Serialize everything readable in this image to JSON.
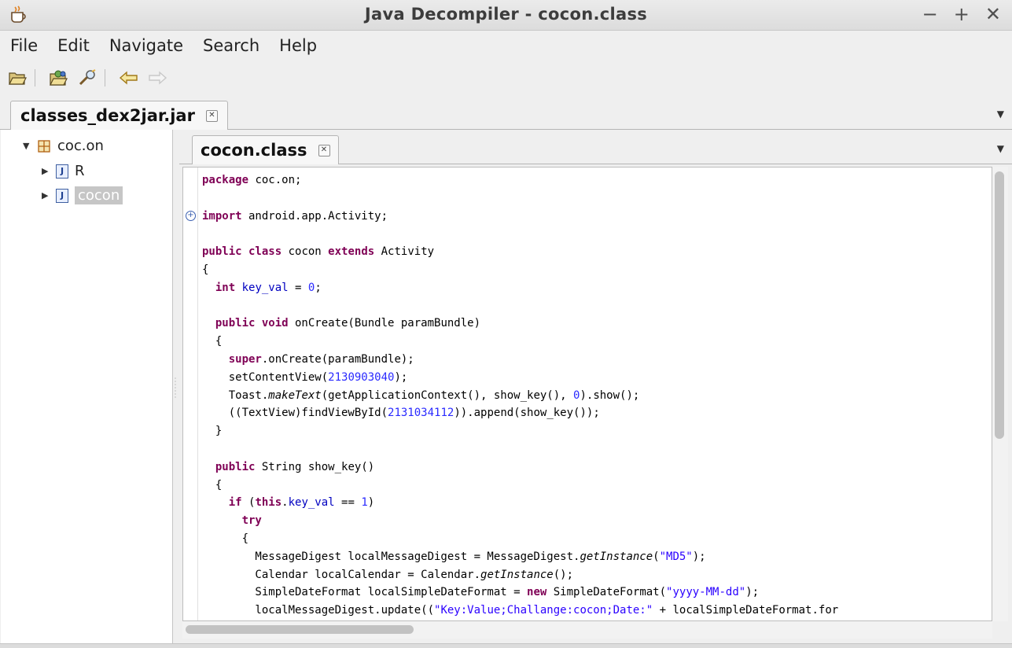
{
  "window": {
    "title": "Java Decompiler - cocon.class",
    "controls": {
      "minimize": "−",
      "maximize": "+",
      "close": "✕"
    }
  },
  "menu": [
    "File",
    "Edit",
    "Navigate",
    "Search",
    "Help"
  ],
  "toolbar": {
    "icons": [
      "open-file-icon",
      "open-type-icon",
      "search-icon",
      "back-arrow-icon",
      "forward-arrow-icon"
    ]
  },
  "outer_tab": {
    "label": "classes_dex2jar.jar",
    "close": "✕"
  },
  "tree": {
    "package": "coc.on",
    "items": [
      {
        "label": "R",
        "icon": "J"
      },
      {
        "label": "cocon",
        "icon": "J",
        "selected": true
      }
    ]
  },
  "editor_tab": {
    "label": "cocon.class",
    "close": "✕"
  },
  "code": {
    "fold_marker": "+"
  }
}
